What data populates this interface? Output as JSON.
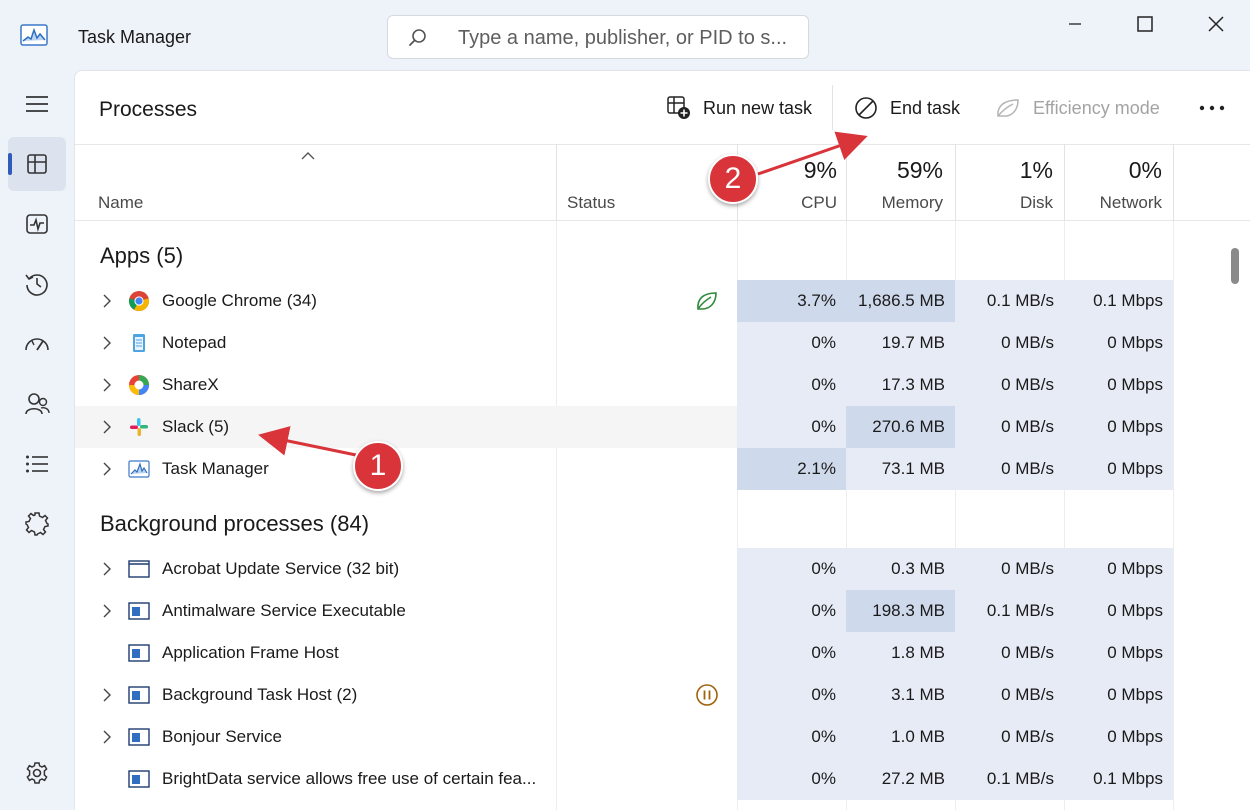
{
  "window": {
    "title": "Task Manager",
    "search_placeholder": "Type a name, publisher, or PID to s..."
  },
  "nav": [
    {
      "icon": "hamburger-icon"
    },
    {
      "icon": "processes-icon",
      "active": true
    },
    {
      "icon": "performance-icon"
    },
    {
      "icon": "app-history-icon"
    },
    {
      "icon": "startup-apps-icon"
    },
    {
      "icon": "users-icon"
    },
    {
      "icon": "details-icon"
    },
    {
      "icon": "services-icon"
    },
    {
      "icon": "settings-icon"
    }
  ],
  "toolbar": {
    "page_title": "Processes",
    "run_new_task": "Run new task",
    "end_task": "End task",
    "efficiency_mode": "Efficiency mode"
  },
  "columns": {
    "name": "Name",
    "status": "Status",
    "cpu": {
      "pct": "9%",
      "label": "CPU"
    },
    "memory": {
      "pct": "59%",
      "label": "Memory"
    },
    "disk": {
      "pct": "1%",
      "label": "Disk"
    },
    "network": {
      "pct": "0%",
      "label": "Network"
    }
  },
  "groups": {
    "apps": "Apps (5)",
    "background": "Background processes (84)"
  },
  "apps": [
    {
      "name": "Google Chrome (34)",
      "icon": "chrome-icon",
      "status_icon": "efficiency-leaf-icon",
      "cpu": "3.7%",
      "memory": "1,686.5 MB",
      "disk": "0.1 MB/s",
      "network": "0.1 Mbps"
    },
    {
      "name": "Notepad",
      "icon": "notepad-icon",
      "cpu": "0%",
      "memory": "19.7 MB",
      "disk": "0 MB/s",
      "network": "0 Mbps"
    },
    {
      "name": "ShareX",
      "icon": "sharex-icon",
      "cpu": "0%",
      "memory": "17.3 MB",
      "disk": "0 MB/s",
      "network": "0 Mbps"
    },
    {
      "name": "Slack (5)",
      "icon": "slack-icon",
      "cpu": "0%",
      "memory": "270.6 MB",
      "disk": "0 MB/s",
      "network": "0 Mbps"
    },
    {
      "name": "Task Manager",
      "icon": "task-manager-icon",
      "cpu": "2.1%",
      "memory": "73.1 MB",
      "disk": "0 MB/s",
      "network": "0 Mbps"
    }
  ],
  "background": [
    {
      "name": "Acrobat Update Service (32 bit)",
      "cpu": "0%",
      "memory": "0.3 MB",
      "disk": "0 MB/s",
      "network": "0 Mbps"
    },
    {
      "name": "Antimalware Service Executable",
      "cpu": "0%",
      "memory": "198.3 MB",
      "disk": "0.1 MB/s",
      "network": "0 Mbps"
    },
    {
      "name": "Application Frame Host",
      "cpu": "0%",
      "memory": "1.8 MB",
      "disk": "0 MB/s",
      "network": "0 Mbps"
    },
    {
      "name": "Background Task Host (2)",
      "status_icon": "suspended-icon",
      "cpu": "0%",
      "memory": "3.1 MB",
      "disk": "0 MB/s",
      "network": "0 Mbps"
    },
    {
      "name": "Bonjour Service",
      "cpu": "0%",
      "memory": "1.0 MB",
      "disk": "0 MB/s",
      "network": "0 Mbps"
    },
    {
      "name": "BrightData service allows free use of certain fea...",
      "cpu": "0%",
      "memory": "27.2 MB",
      "disk": "0.1 MB/s",
      "network": "0.1 Mbps"
    }
  ],
  "annotations": {
    "badge1": "1",
    "badge2": "2"
  },
  "colors": {
    "heat_light": "#e6ebf5",
    "heat_mid": "#cfd9ec",
    "accent": "#2f5cb8",
    "annotation": "#d8343a"
  }
}
